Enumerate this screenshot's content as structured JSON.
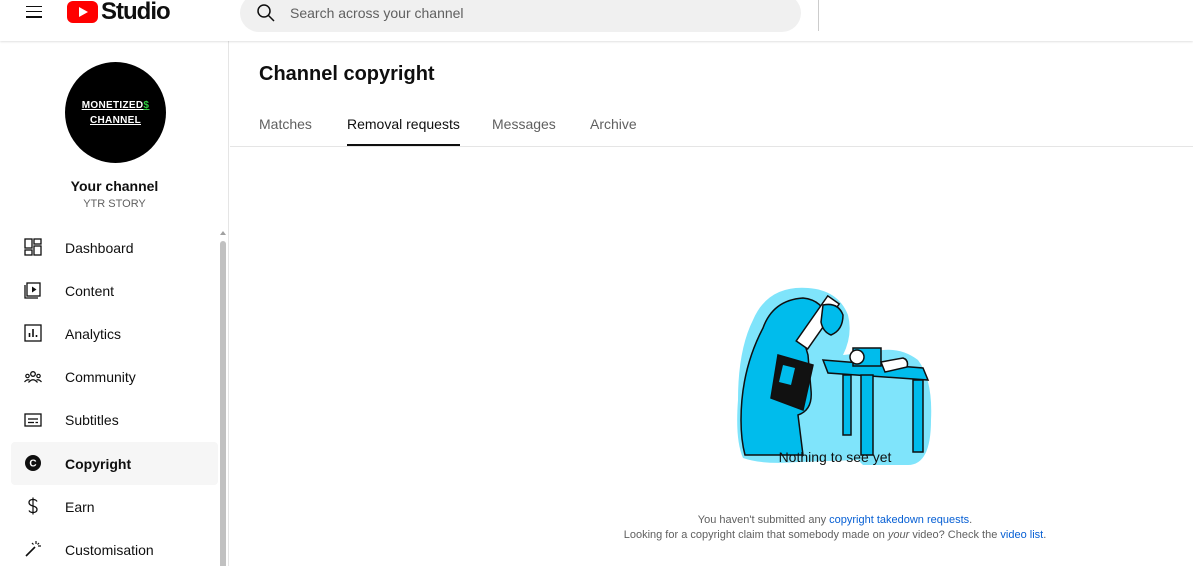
{
  "header": {
    "logo_text": "Studio",
    "search_placeholder": "Search across your channel"
  },
  "channel": {
    "avatar_line1": "MONETIZED",
    "avatar_symbol": "$",
    "avatar_line2": "CHANNEL",
    "title": "Your channel",
    "name": "YTR STORY"
  },
  "sidebar": {
    "items": [
      {
        "label": "Dashboard",
        "icon": "dashboard-icon"
      },
      {
        "label": "Content",
        "icon": "content-icon"
      },
      {
        "label": "Analytics",
        "icon": "analytics-icon"
      },
      {
        "label": "Community",
        "icon": "community-icon"
      },
      {
        "label": "Subtitles",
        "icon": "subtitles-icon"
      },
      {
        "label": "Copyright",
        "icon": "copyright-icon",
        "active": true
      },
      {
        "label": "Earn",
        "icon": "dollar-icon"
      },
      {
        "label": "Customisation",
        "icon": "magic-wand-icon"
      }
    ]
  },
  "main": {
    "title": "Channel copyright",
    "tabs": [
      {
        "label": "Matches"
      },
      {
        "label": "Removal requests",
        "active": true
      },
      {
        "label": "Messages"
      },
      {
        "label": "Archive"
      }
    ],
    "empty": {
      "title": "Nothing to see yet",
      "line1_prefix": "You haven't submitted any ",
      "line1_link": "copyright takedown requests",
      "line1_suffix": ".",
      "line2_prefix": "Looking for a copyright claim that somebody made on ",
      "line2_em": "your",
      "line2_mid": " video? Check the ",
      "line2_link": "video list",
      "line2_suffix": "."
    }
  },
  "colors": {
    "brand_red": "#ff0000",
    "link_blue": "#065fd4",
    "illustration_cyan": "#00bcec",
    "illustration_bg": "#7fe4fb"
  }
}
